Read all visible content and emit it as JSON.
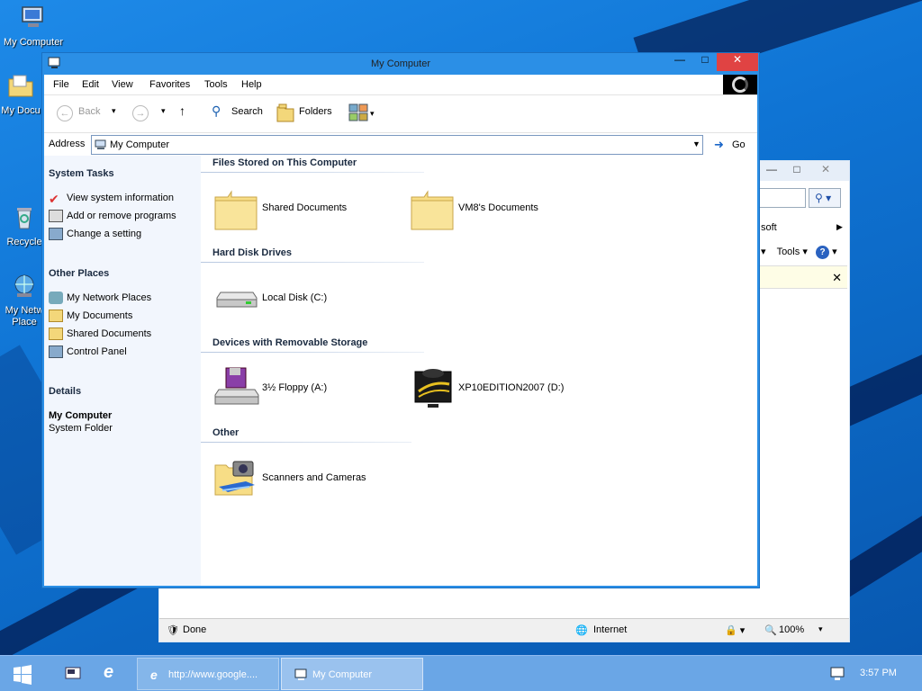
{
  "desktop": {
    "icons": [
      {
        "label": "My Computer"
      },
      {
        "label": "My Docu"
      },
      {
        "label": "Recycle"
      },
      {
        "label_line1": "My Netw",
        "label_line2": "Place"
      }
    ]
  },
  "ie_window": {
    "partial_menu": "soft",
    "tools_label": "Tools",
    "status_done": "Done",
    "status_zone": "Internet",
    "status_zoom": "100%"
  },
  "window": {
    "title": "My Computer",
    "menu": [
      "File",
      "Edit",
      "View",
      "Favorites",
      "Tools",
      "Help"
    ],
    "toolbar": {
      "back": "Back",
      "search": "Search",
      "folders": "Folders"
    },
    "address": {
      "label": "Address",
      "value": "My Computer",
      "go": "Go"
    }
  },
  "taskpane": {
    "system_tasks": {
      "title": "System Tasks",
      "items": [
        "View system information",
        "Add or remove programs",
        "Change a setting"
      ]
    },
    "other_places": {
      "title": "Other Places",
      "items": [
        "My Network Places",
        "My Documents",
        "Shared Documents",
        "Control Panel"
      ]
    },
    "details": {
      "title": "Details",
      "name": "My Computer",
      "type": "System Folder"
    }
  },
  "content": {
    "groups": [
      {
        "title": "Files Stored on This Computer",
        "items": [
          "Shared Documents",
          "VM8's Documents"
        ]
      },
      {
        "title": "Hard Disk Drives",
        "items": [
          "Local Disk (C:)"
        ]
      },
      {
        "title": "Devices with Removable Storage",
        "items": [
          "3½ Floppy (A:)",
          "XP10EDITION2007 (D:)"
        ]
      },
      {
        "title": "Other",
        "items": [
          "Scanners and Cameras"
        ]
      }
    ]
  },
  "taskbar": {
    "ie_task": "http://www.google....",
    "mc_task": "My Computer",
    "clock": "3:57 PM"
  },
  "colors": {
    "desktop": "#0f74d4",
    "window_frame": "#2b8fe6",
    "close_button": "#e04343",
    "taskpane": "#f2f6fd"
  }
}
